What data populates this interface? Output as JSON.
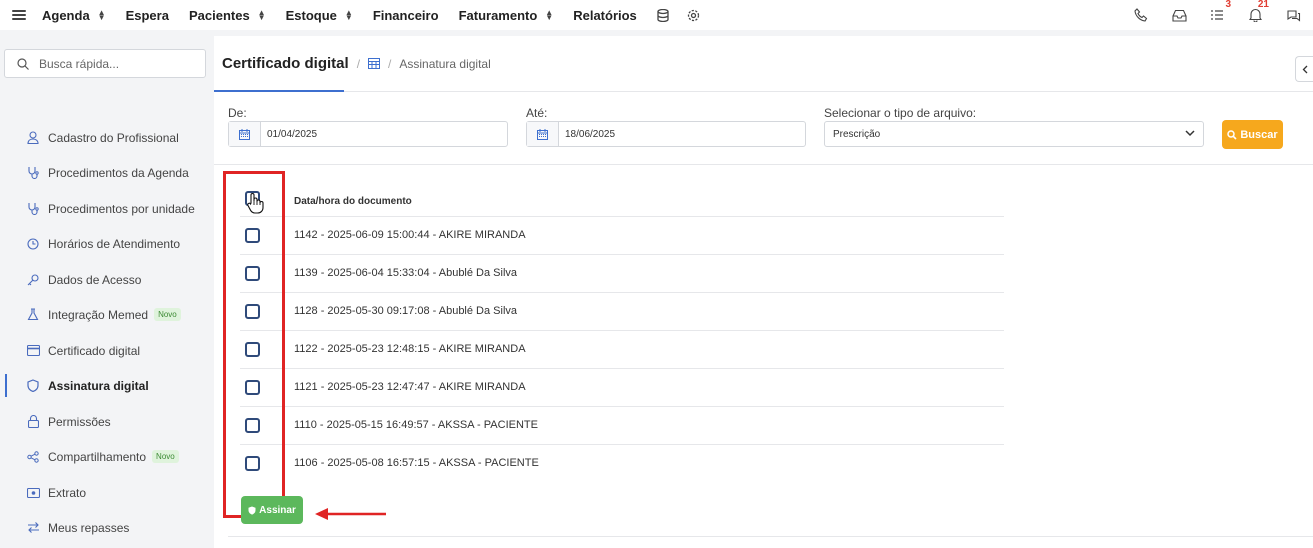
{
  "topnav": {
    "items": [
      {
        "label": "Agenda",
        "caret": true
      },
      {
        "label": "Espera",
        "caret": false
      },
      {
        "label": "Pacientes",
        "caret": true
      },
      {
        "label": "Estoque",
        "caret": true
      },
      {
        "label": "Financeiro",
        "caret": false
      },
      {
        "label": "Faturamento",
        "caret": true
      },
      {
        "label": "Relatórios",
        "caret": false
      }
    ],
    "badges": {
      "tasks": "3",
      "notifications": "21"
    }
  },
  "sidebar": {
    "search_placeholder": "Busca rápida...",
    "items": [
      {
        "label": "Cadastro do Profissional",
        "icon": "user-doctor-icon"
      },
      {
        "label": "Procedimentos da Agenda",
        "icon": "stethoscope-icon"
      },
      {
        "label": "Procedimentos por unidade",
        "icon": "stethoscope-icon"
      },
      {
        "label": "Horários de Atendimento",
        "icon": "clock-icon"
      },
      {
        "label": "Dados de Acesso",
        "icon": "key-icon"
      },
      {
        "label": "Integração Memed",
        "icon": "flask-icon",
        "badge": "Novo"
      },
      {
        "label": "Certificado digital",
        "icon": "credit-card-icon"
      },
      {
        "label": "Assinatura digital",
        "icon": "shield-icon",
        "active": true
      },
      {
        "label": "Permissões",
        "icon": "lock-icon"
      },
      {
        "label": "Compartilhamento",
        "icon": "share-icon",
        "badge": "Novo"
      },
      {
        "label": "Extrato",
        "icon": "money-icon"
      },
      {
        "label": "Meus repasses",
        "icon": "transfer-icon"
      }
    ]
  },
  "breadcrumb": {
    "title": "Certificado digital",
    "sub": "Assinatura digital"
  },
  "filters": {
    "from_label": "De:",
    "from_value": "01/04/2025",
    "to_label": "Até:",
    "to_value": "18/06/2025",
    "type_label": "Selecionar o tipo de arquivo:",
    "type_value": "Prescrição",
    "search_button": "Buscar"
  },
  "documents": {
    "header": "Data/hora do documento",
    "rows": [
      "1142 - 2025-06-09 15:00:44 - AKIRE MIRANDA",
      "1139 - 2025-06-04 15:33:04 - Abublé Da Silva",
      "1128 - 2025-05-30 09:17:08 - Abublé Da Silva",
      "1122 - 2025-05-23 12:48:15 - AKIRE MIRANDA",
      "1121 - 2025-05-23 12:47:47 - AKIRE MIRANDA",
      "1110 - 2025-05-15 16:49:57 - AKSSA - PACIENTE",
      "1106 - 2025-05-08 16:57:15 - AKSSA - PACIENTE"
    ]
  },
  "sign_button": "Assinar",
  "colors": {
    "accent": "#3d6fcf",
    "search_button": "#f6a81d",
    "sign_button": "#5cb85c",
    "highlight": "#e02424"
  }
}
